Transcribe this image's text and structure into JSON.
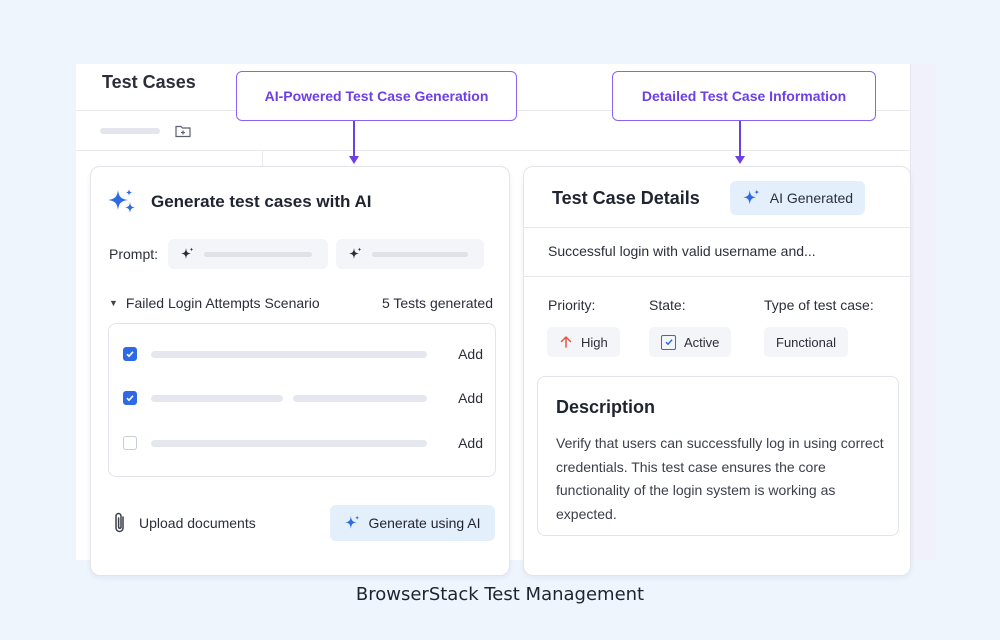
{
  "app": {
    "title": "Test Cases"
  },
  "generator": {
    "title": "Generate test cases with AI",
    "prompt_label": "Prompt:",
    "scenario_name": "Failed Login Attempts Scenario",
    "scenario_count": "5 Tests generated",
    "test_rows": [
      {
        "checked": true,
        "add_label": "Add"
      },
      {
        "checked": true,
        "add_label": "Add"
      },
      {
        "checked": false,
        "add_label": "Add"
      }
    ],
    "upload_label": "Upload documents",
    "generate_label": "Generate using AI"
  },
  "details": {
    "title": "Test Case Details",
    "badge": "AI Generated",
    "case_name": "Successful login with valid username and...",
    "priority_label": "Priority:",
    "priority_value": "High",
    "state_label": "State:",
    "state_value": "Active",
    "type_label": "Type of test case:",
    "type_value": "Functional",
    "description_title": "Description",
    "description_text": "Verify that users can successfully log in using correct credentials. This test case ensures the core functionality of the login system is working as expected."
  },
  "callouts": {
    "left": "AI-Powered Test Case Generation",
    "right": "Detailed Test Case Information"
  },
  "caption": "BrowserStack Test Management",
  "colors": {
    "accent": "#2d6ae3",
    "callout": "#6d3fe6",
    "priority_high": "#e5553f",
    "background": "#eef5fd"
  }
}
